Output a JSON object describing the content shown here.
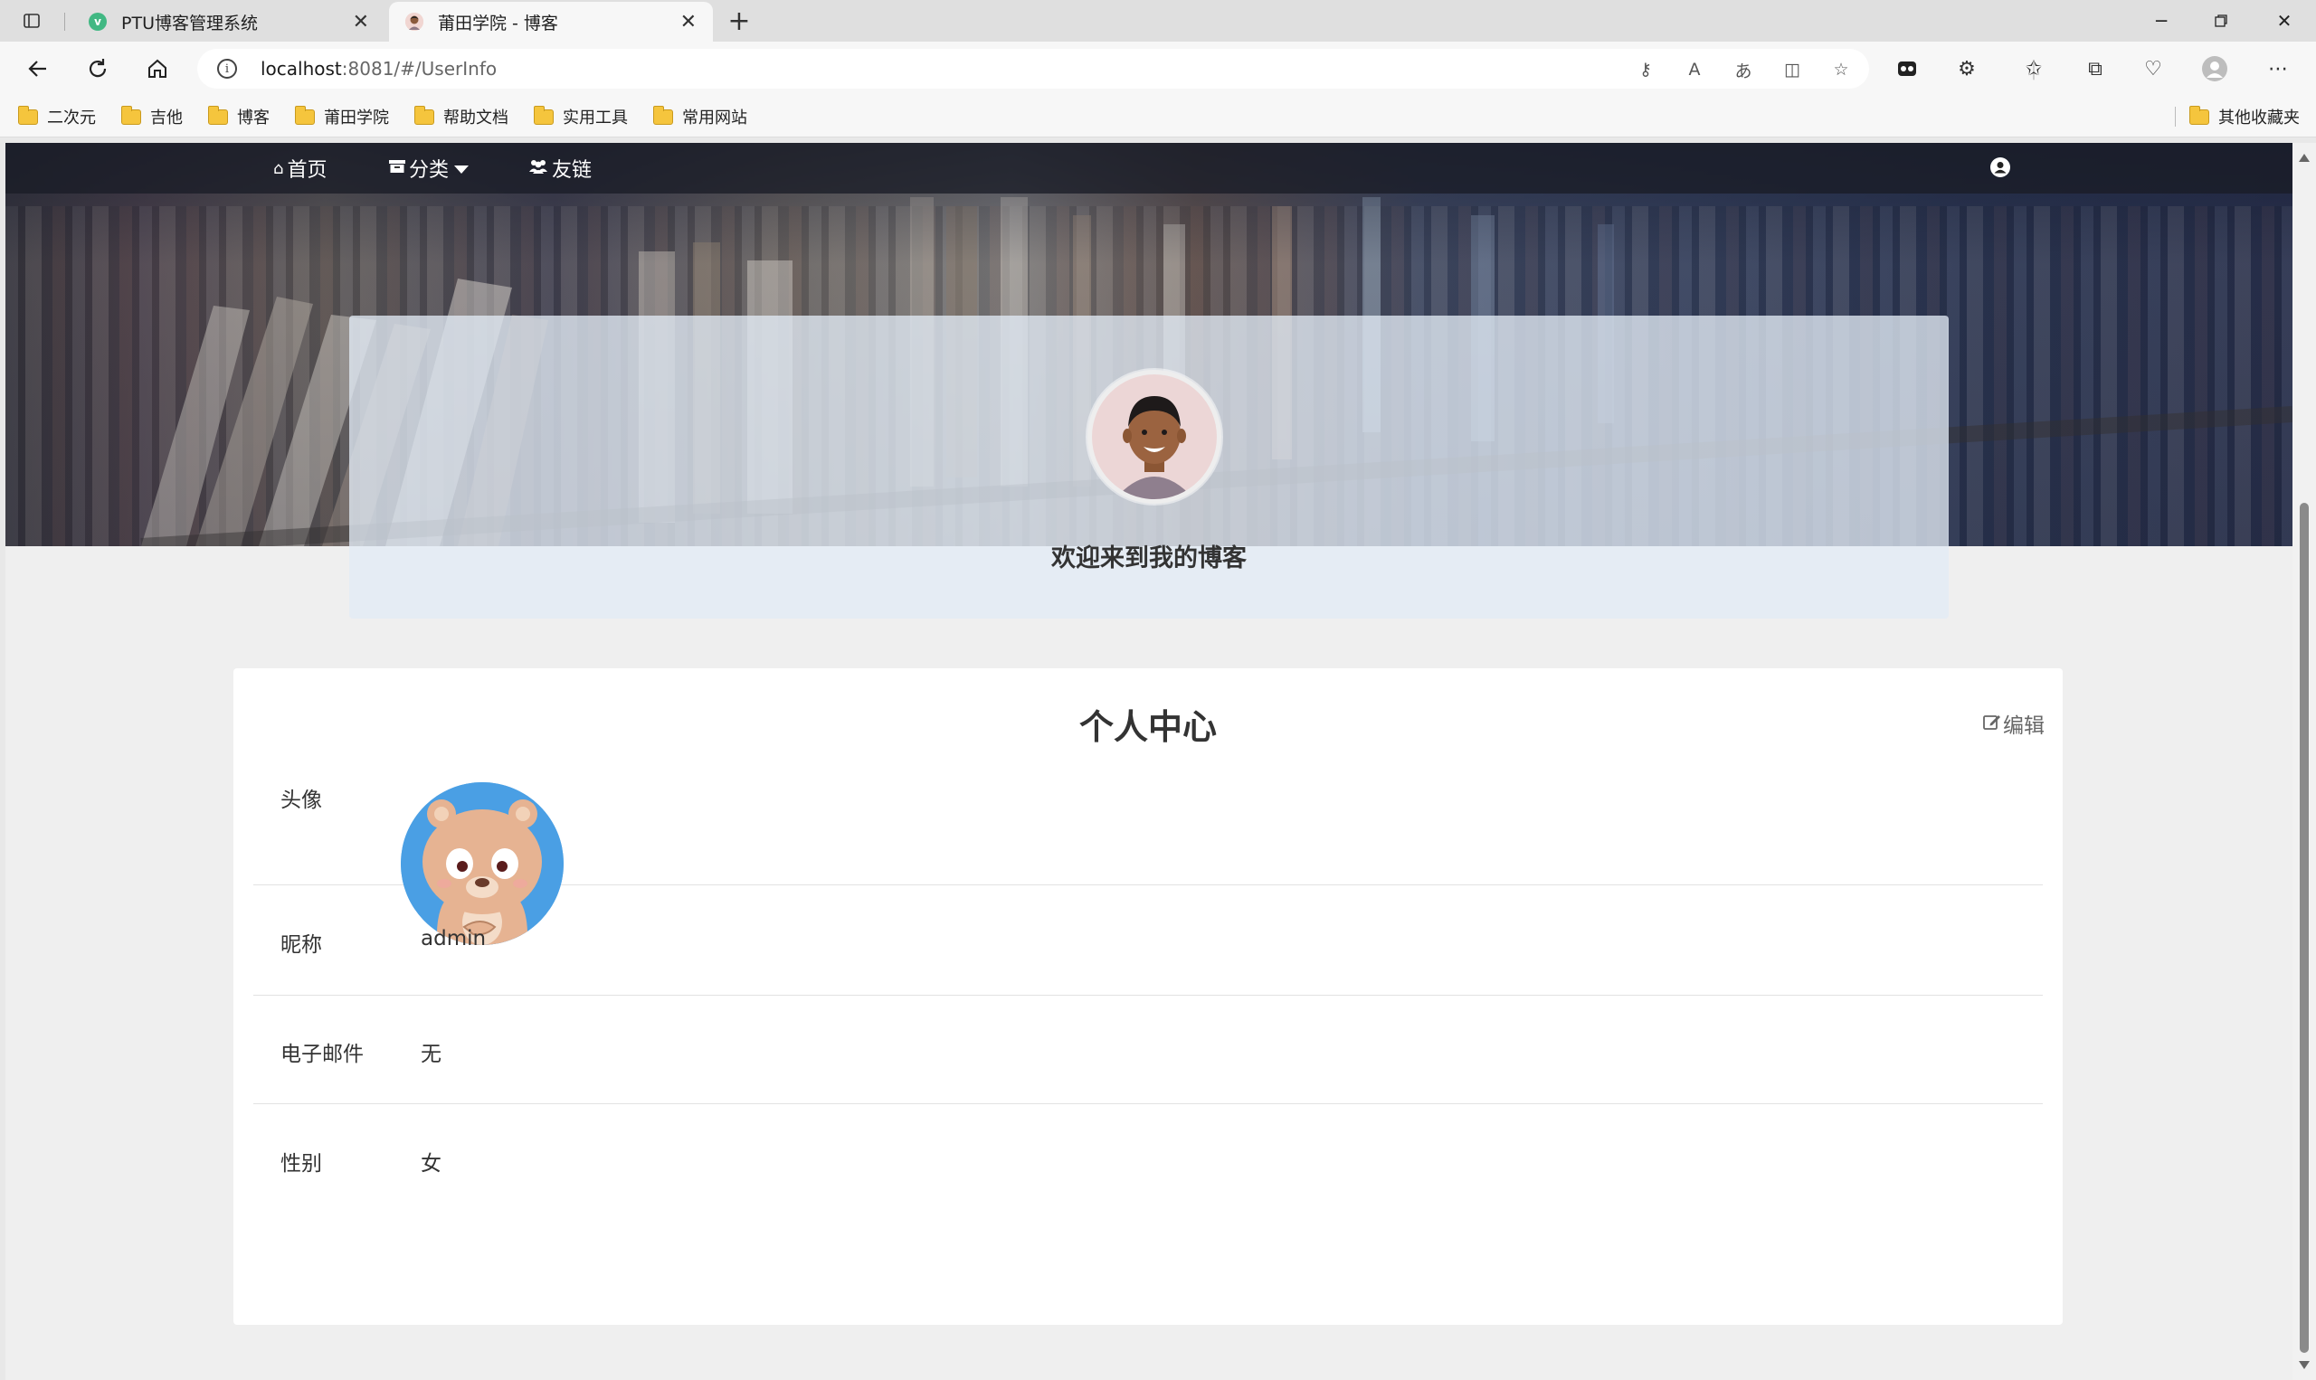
{
  "browser": {
    "tabs": [
      {
        "title": "PTU博客管理系统",
        "active": false,
        "favicon": "vue-icon"
      },
      {
        "title": "莆田学院 - 博客",
        "active": true,
        "favicon": "avatar-favicon"
      }
    ],
    "url_host": "localhost",
    "url_rest": ":8081/#/UserInfo",
    "bookmarks": [
      "二次元",
      "吉他",
      "博客",
      "莆田学院",
      "帮助文档",
      "实用工具",
      "常用网站"
    ],
    "other_bookmarks": "其他收藏夹"
  },
  "nav": {
    "home": "首页",
    "category": "分类",
    "links": "友链"
  },
  "welcome": {
    "text": "欢迎来到我的博客"
  },
  "profile": {
    "title": "个人中心",
    "edit_label": "编辑",
    "fields": [
      {
        "label": "头像",
        "value": ""
      },
      {
        "label": "昵称",
        "value": "admin"
      },
      {
        "label": "电子邮件",
        "value": "无"
      },
      {
        "label": "性别",
        "value": "女"
      }
    ]
  },
  "colors": {
    "nav_bg": "#191c26",
    "card_bg": "#ffffff",
    "page_bg": "#efefef",
    "bear_bg": "#4a9fe4"
  }
}
